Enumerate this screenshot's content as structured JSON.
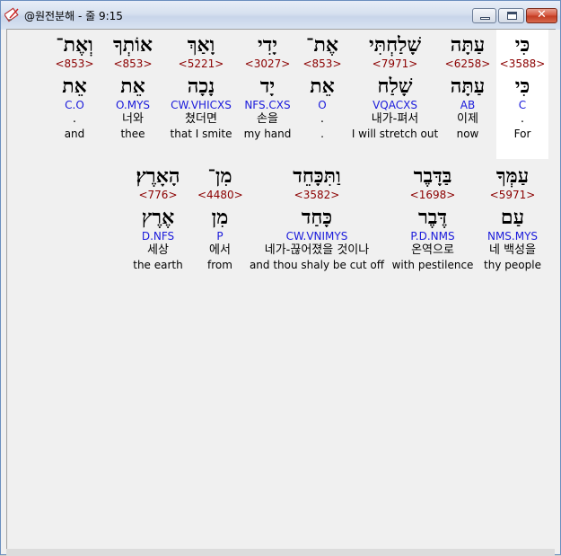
{
  "window": {
    "title": "@원전분해 - 줄 9:15"
  },
  "line1": [
    {
      "heb": "כִּי",
      "strong": "<3588>",
      "lemma": "כִּי",
      "morph": "C",
      "ko": ".",
      "en": "For"
    },
    {
      "heb": "עַתָּה",
      "strong": "<6258>",
      "lemma": "עַתָּה",
      "morph": "AB",
      "ko": "이제",
      "en": "now"
    },
    {
      "heb": "שָׁלַחְתִּי",
      "strong": "<7971>",
      "lemma": "שָׁלַח",
      "morph": "VQACXS",
      "ko": "내가-펴서",
      "en": "I will stretch out"
    },
    {
      "heb": "אֶת־",
      "strong": "<853>",
      "lemma": "אֵת",
      "morph": "O",
      "ko": ".",
      "en": "."
    },
    {
      "heb": "יָדִי",
      "strong": "<3027>",
      "lemma": "יָד",
      "morph": "NFS.CXS",
      "ko": "손을",
      "en": "my hand"
    },
    {
      "heb": "וָאַךְ",
      "strong": "<5221>",
      "lemma": "נָכָה",
      "morph": "CW.VHICXS",
      "ko": "쳤더면",
      "en": "that I smite"
    },
    {
      "heb": "אוֹתְךָ",
      "strong": "<853>",
      "lemma": "אֵת",
      "morph": "O.MYS",
      "ko": "너와",
      "en": "thee"
    },
    {
      "heb": "וְאֶת־",
      "strong": "<853>",
      "lemma": "אֵת",
      "morph": "C.O",
      "ko": ".",
      "en": "and"
    }
  ],
  "line2": [
    {
      "heb": "עַמְּךָ",
      "strong": "<5971>",
      "lemma": "עַם",
      "morph": "NMS.MYS",
      "ko": "네 백성을",
      "en": "thy people"
    },
    {
      "heb": "בַּדָּבֶר",
      "strong": "<1698>",
      "lemma": "דֶּבֶר",
      "morph": "P.D.NMS",
      "ko": "온역으로",
      "en": "with pestilence"
    },
    {
      "heb": "וַתִּכָּחֵד",
      "strong": "<3582>",
      "lemma": "כָּחַד",
      "morph": "CW.VNIMYS",
      "ko": "네가-끊어졌을 것이나",
      "en": "and thou shaly be cut off"
    },
    {
      "heb": "מִן־",
      "strong": "<4480>",
      "lemma": "מִן",
      "morph": "P",
      "ko": "에서",
      "en": "from"
    },
    {
      "heb": "הָאָרֶץ׃",
      "strong": "<776>",
      "lemma": "אֶרֶץ",
      "morph": "D.NFS",
      "ko": "세상",
      "en": "the earth"
    }
  ]
}
